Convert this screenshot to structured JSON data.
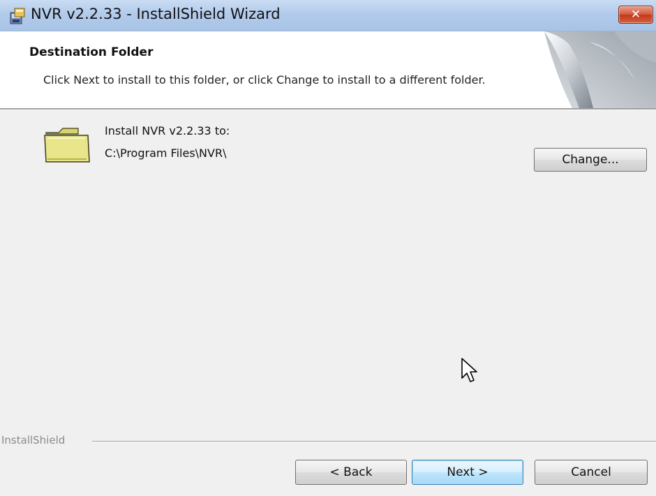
{
  "window": {
    "title": "NVR v2.2.33 - InstallShield Wizard",
    "close_glyph": "✕"
  },
  "banner": {
    "title": "Destination Folder",
    "subtitle": "Click Next to install to this folder, or click Change to install to a different folder."
  },
  "destination": {
    "label": "Install NVR v2.2.33 to:",
    "path": "C:\\Program Files\\NVR\\",
    "change_label": "Change..."
  },
  "footer": {
    "brand": "InstallShield",
    "back_label": "< Back",
    "next_label": "Next >",
    "cancel_label": "Cancel"
  },
  "icons": {
    "app": "installer-app-icon",
    "folder": "folder-icon",
    "banner_art": "page-curl-graphic",
    "cursor": "mouse-pointer-icon"
  },
  "colors": {
    "titlebar": "#b3cbeb",
    "close_button": "#c2391b",
    "dialog_background": "#f0f0f0",
    "banner_background": "#ffffff",
    "default_button": "#bee6fd",
    "folder": "#e8e58a"
  }
}
